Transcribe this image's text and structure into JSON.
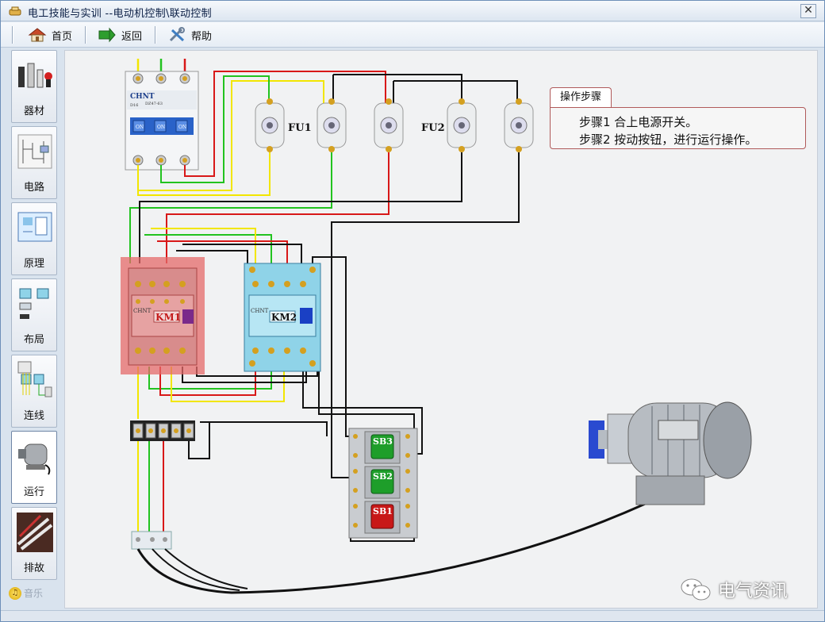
{
  "window": {
    "title": "电工技能与实训 --电动机控制\\联动控制",
    "close_glyph": "✕"
  },
  "toolbar": {
    "home_label": "首页",
    "back_label": "返回",
    "help_label": "帮助"
  },
  "sidebar": {
    "items": [
      {
        "label": "器材",
        "icon": "equipment-icon"
      },
      {
        "label": "电路",
        "icon": "circuit-icon"
      },
      {
        "label": "原理",
        "icon": "schematic-icon"
      },
      {
        "label": "布局",
        "icon": "layout-icon"
      },
      {
        "label": "连线",
        "icon": "wiring-icon"
      },
      {
        "label": "运行",
        "icon": "motor-run-icon"
      },
      {
        "label": "排故",
        "icon": "troubleshoot-icon"
      }
    ],
    "music_label": "音乐"
  },
  "diagram": {
    "fuse_group_1": "FU1",
    "fuse_group_2": "FU2",
    "contactor_1": "KM1",
    "contactor_2": "KM2",
    "breaker_brand": "CHNT",
    "breaker_model": "DZ47-63",
    "breaker_rating": "D16",
    "breaker_switch_text": "ON",
    "contactor_brand": "CHNT",
    "button_3": "SB3",
    "button_2": "SB2",
    "button_1": "SB1"
  },
  "steps_panel": {
    "tab_label": "操作步骤",
    "step1": "步骤1  合上电源开关。",
    "step2": "步骤2  按动按钮，进行运行操作。"
  },
  "watermark": {
    "text": "电气资讯"
  },
  "colors": {
    "wire_yellow": "#f2e600",
    "wire_green": "#22c31f",
    "wire_red": "#d81818",
    "wire_black": "#111111",
    "km1_highlight": "#e46a6a",
    "km2_body": "#8fd3e8"
  }
}
